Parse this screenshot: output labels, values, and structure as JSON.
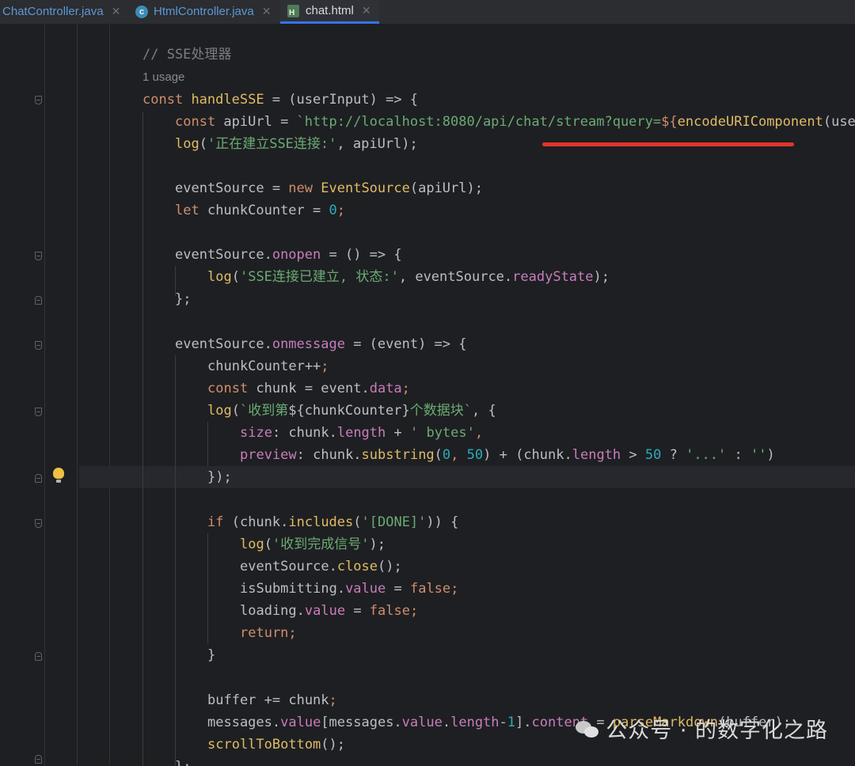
{
  "tabs": [
    {
      "label": "ChatController.java",
      "icon": "java-class-icon",
      "active": false,
      "close": "✕"
    },
    {
      "label": "HtmlController.java",
      "icon": "c",
      "active": false,
      "close": "✕"
    },
    {
      "label": "chat.html",
      "icon": "H",
      "active": true,
      "close": "✕"
    }
  ],
  "editor": {
    "usage_hint": "1 usage",
    "code": {
      "l1": "// SSE处理器",
      "l3_kw": "const",
      "l3_fn": "handleSSE",
      "l3_rest": " = (userInput) => {",
      "l4_kw": "const",
      "l4_var": " apiUrl = ",
      "l4_str": "`http://localhost:8080/api/chat/stream?query=",
      "l4_tpl": "${",
      "l4_fn": "encodeURIComponent",
      "l4_tail": "(use",
      "l5_fn": "log",
      "l5_a": "(",
      "l5_str": "'正在建立SSE连接:'",
      "l5_b": ", apiUrl);",
      "l7_a": "eventSource = ",
      "l7_kw": "new",
      "l7_sp": " ",
      "l7_fn": "EventSource",
      "l7_b": "(apiUrl);",
      "l8_kw": "let",
      "l8_a": " chunkCounter = ",
      "l8_n": "0",
      "l8_b": ";",
      "l10_a": "eventSource.",
      "l10_p": "onopen",
      "l10_b": " = () => {",
      "l11_fn": "log",
      "l11_a": "(",
      "l11_str": "'SSE连接已建立, 状态:'",
      "l11_b": ", eventSource.",
      "l11_p": "readyState",
      "l11_c": ");",
      "l12": "};",
      "l14_a": "eventSource.",
      "l14_p": "onmessage",
      "l14_b": " = (event) => {",
      "l15_a": "chunkCounter++",
      "l15_b": ";",
      "l16_kw": "const",
      "l16_a": " chunk = event.",
      "l16_p": "data",
      "l16_b": ";",
      "l17_fn": "log",
      "l17_a": "(",
      "l17_str1": "`收到第",
      "l17_tpl": "${chunkCounter}",
      "l17_str2": "个数据块`",
      "l17_b": ", {",
      "l18_p": "size",
      "l18_a": ": chunk.",
      "l18_p2": "length",
      "l18_b": " + ",
      "l18_str": "' bytes'",
      "l18_c": ",",
      "l19_p": "preview",
      "l19_a": ": chunk.",
      "l19_fn": "substring",
      "l19_b": "(",
      "l19_n1": "0",
      "l19_c": ", ",
      "l19_n2": "50",
      "l19_d": ") + (chunk.",
      "l19_p2": "length",
      "l19_e": " > ",
      "l19_n3": "50",
      "l19_f": " ? ",
      "l19_s1": "'...'",
      "l19_g": " : ",
      "l19_s2": "''",
      "l19_h": ")",
      "l20": "});",
      "l22_kw": "if",
      "l22_a": " (chunk.",
      "l22_fn": "includes",
      "l22_b": "(",
      "l22_str": "'[DONE]'",
      "l22_c": ")) {",
      "l23_fn": "log",
      "l23_a": "(",
      "l23_str": "'收到完成信号'",
      "l23_b": ");",
      "l24_a": "eventSource.",
      "l24_fn": "close",
      "l24_b": "();",
      "l25_a": "isSubmitting.",
      "l25_p": "value",
      "l25_b": " = ",
      "l25_kw": "false",
      "l25_c": ";",
      "l26_a": "loading.",
      "l26_p": "value",
      "l26_b": " = ",
      "l26_kw": "false",
      "l26_c": ";",
      "l27_kw": "return",
      "l27_b": ";",
      "l28": "}",
      "l30_a": "buffer += chunk",
      "l30_b": ";",
      "l31_a": "messages.",
      "l31_p": "value",
      "l31_b": "[messages.",
      "l31_p2": "value",
      "l31_c": ".",
      "l31_p3": "length",
      "l31_d": "-",
      "l31_n": "1",
      "l31_e": "].",
      "l31_p4": "content",
      "l31_f": " = ",
      "l31_fn": "parseMarkdown",
      "l31_g": "(buffer);",
      "l32_fn": "scrollToBottom",
      "l32_b": "();",
      "l33": "};"
    }
  },
  "watermark": {
    "text": "公众号 · 的数字化之路"
  },
  "colors": {
    "underline": "#e0352b",
    "active_tab": "#3574f0"
  }
}
